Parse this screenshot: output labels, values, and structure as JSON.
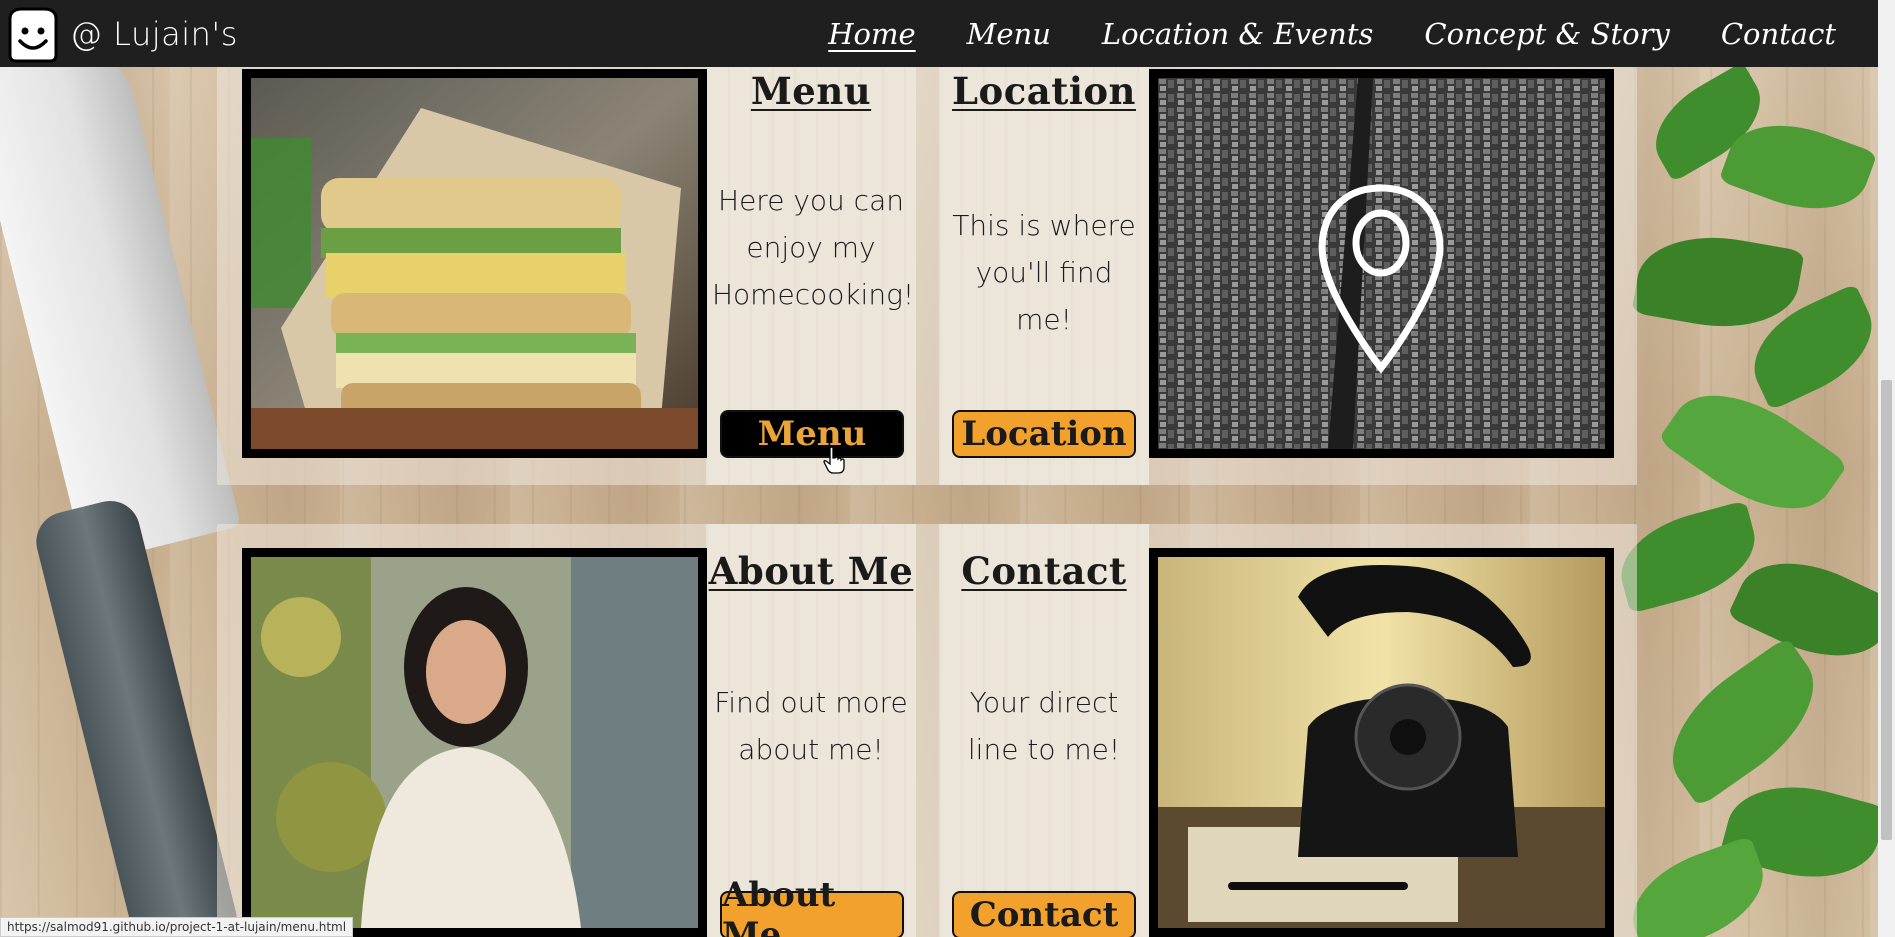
{
  "navbar": {
    "brand": "@ Lujain's",
    "links": [
      {
        "label": "Home",
        "active": true
      },
      {
        "label": "Menu",
        "active": false
      },
      {
        "label": "Location & Events",
        "active": false
      },
      {
        "label": "Concept & Story",
        "active": false
      },
      {
        "label": "Contact",
        "active": false
      }
    ]
  },
  "cards": {
    "menu": {
      "title": "Menu",
      "text": "Here you can enjoy my Homecooking!",
      "button": "Menu",
      "image": "sandwich-photo"
    },
    "location": {
      "title": "Location",
      "text": "This is where you'll find me!",
      "button": "Location",
      "image": "city-map-pin-photo"
    },
    "about": {
      "title": "About Me",
      "text": "Find out more about me!",
      "button": "About Me",
      "image": "portrait-photo"
    },
    "contact": {
      "title": "Contact",
      "text": "Your direct line to me!",
      "button": "Contact",
      "image": "rotary-telephone-photo"
    }
  },
  "status_bar": {
    "url": "https://salmod91.github.io/project-1-at-lujain/menu.html"
  },
  "colors": {
    "navbar_bg": "#1f1f1f",
    "button_orange": "#f2a22c",
    "button_dark": "#000000",
    "button_dark_text": "#e9a53a"
  }
}
